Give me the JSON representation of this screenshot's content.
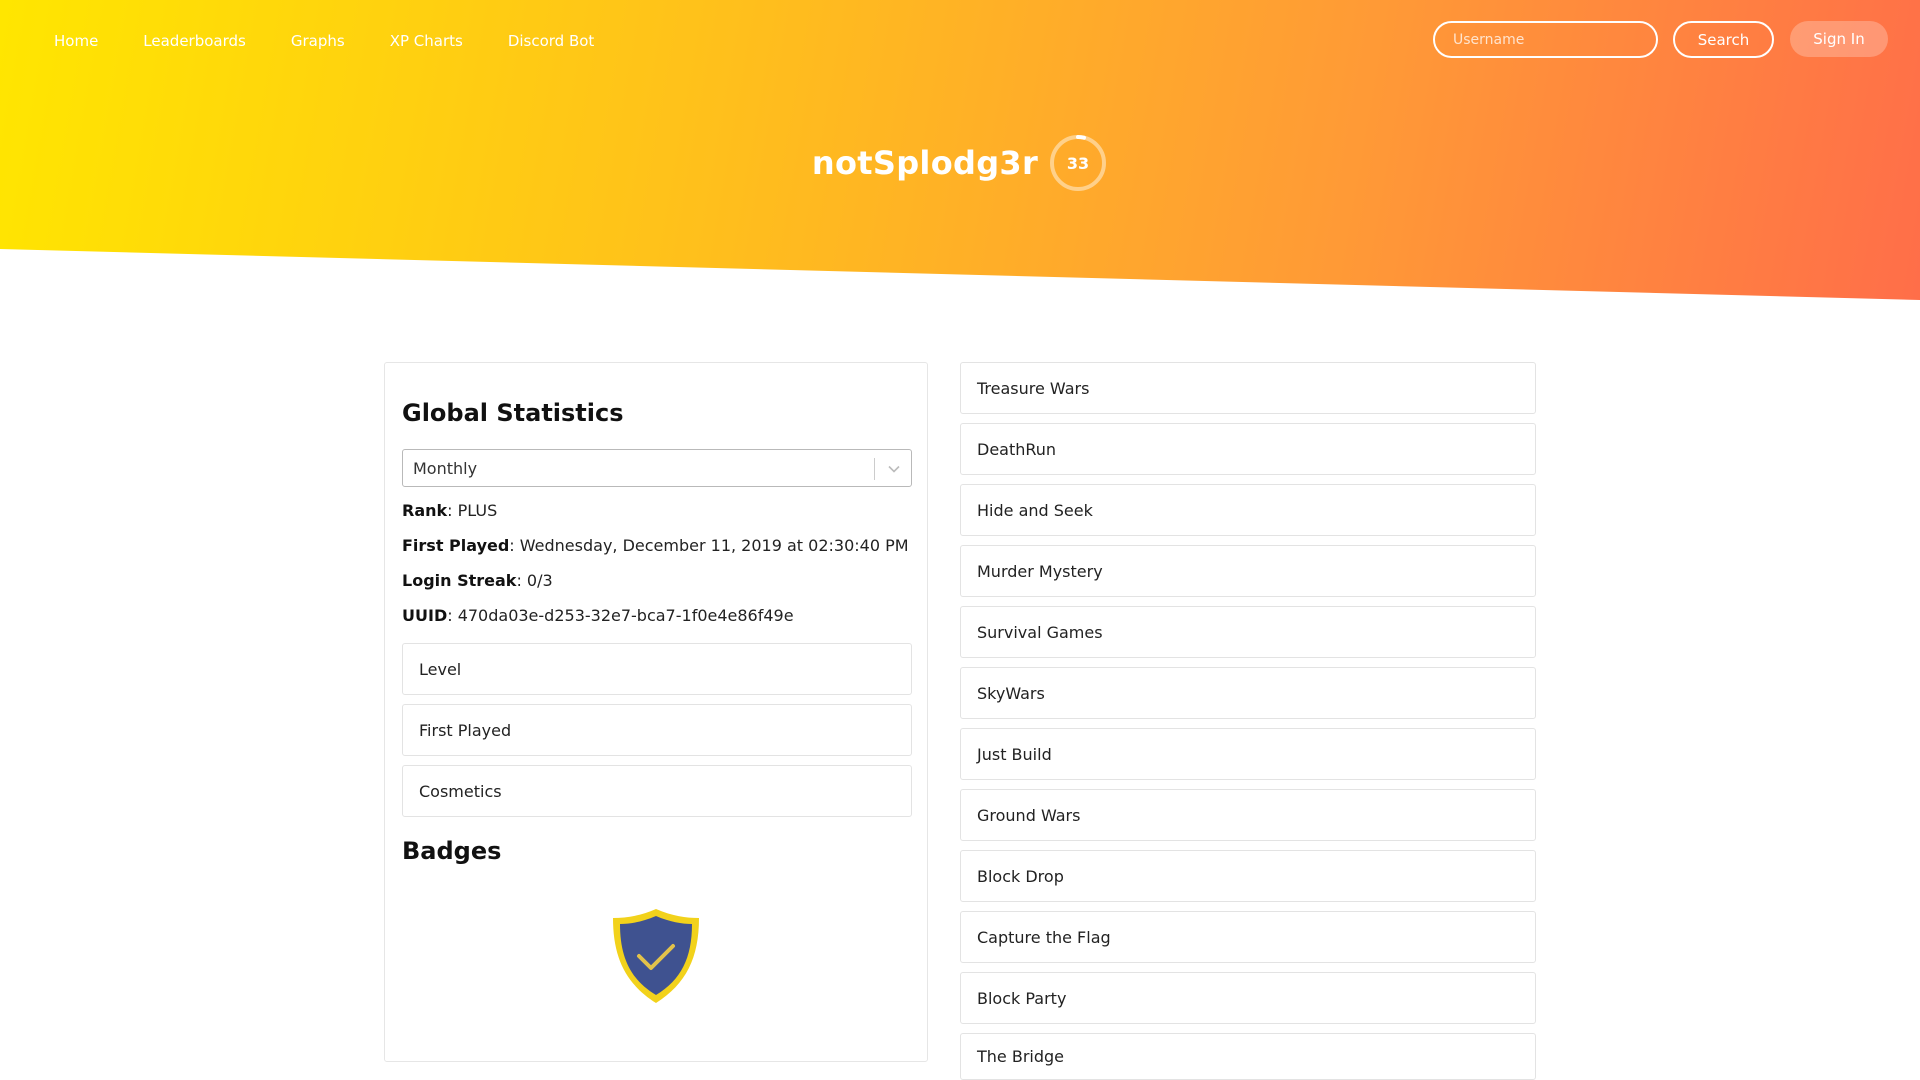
{
  "nav": {
    "items": [
      "Home",
      "Leaderboards",
      "Graphs",
      "XP Charts",
      "Discord Bot"
    ]
  },
  "search": {
    "placeholder": "Username",
    "button_label": "Search"
  },
  "auth": {
    "signin_label": "Sign In"
  },
  "player": {
    "name": "notSplodg3r",
    "level": "33"
  },
  "global_stats": {
    "title": "Global Statistics",
    "period": "Monthly",
    "rank_label": "Rank",
    "rank_value": ": PLUS",
    "first_played_label": "First Played",
    "first_played_value": ": Wednesday, December 11, 2019 at 02:30:40 PM",
    "login_streak_label": "Login Streak",
    "login_streak_value": ": 0/3",
    "uuid_label": "UUID",
    "uuid_value": ": 470da03e-d253-32e7-bca7-1f0e4e86f49e",
    "panels": [
      "Level",
      "First Played",
      "Cosmetics"
    ]
  },
  "badges": {
    "title": "Badges"
  },
  "games": [
    "Treasure Wars",
    "DeathRun",
    "Hide and Seek",
    "Murder Mystery",
    "Survival Games",
    "SkyWars",
    "Just Build",
    "Ground Wars",
    "Block Drop",
    "Capture the Flag",
    "Block Party",
    "The Bridge"
  ],
  "colors": {
    "gradient_start": "#ffe600",
    "gradient_end": "#ff6e49",
    "badge_fill": "#3f5290",
    "badge_border": "#f2d21b"
  },
  "icons": {
    "dropdown": "chevron-down-icon",
    "badge": "verified-shield-icon"
  }
}
